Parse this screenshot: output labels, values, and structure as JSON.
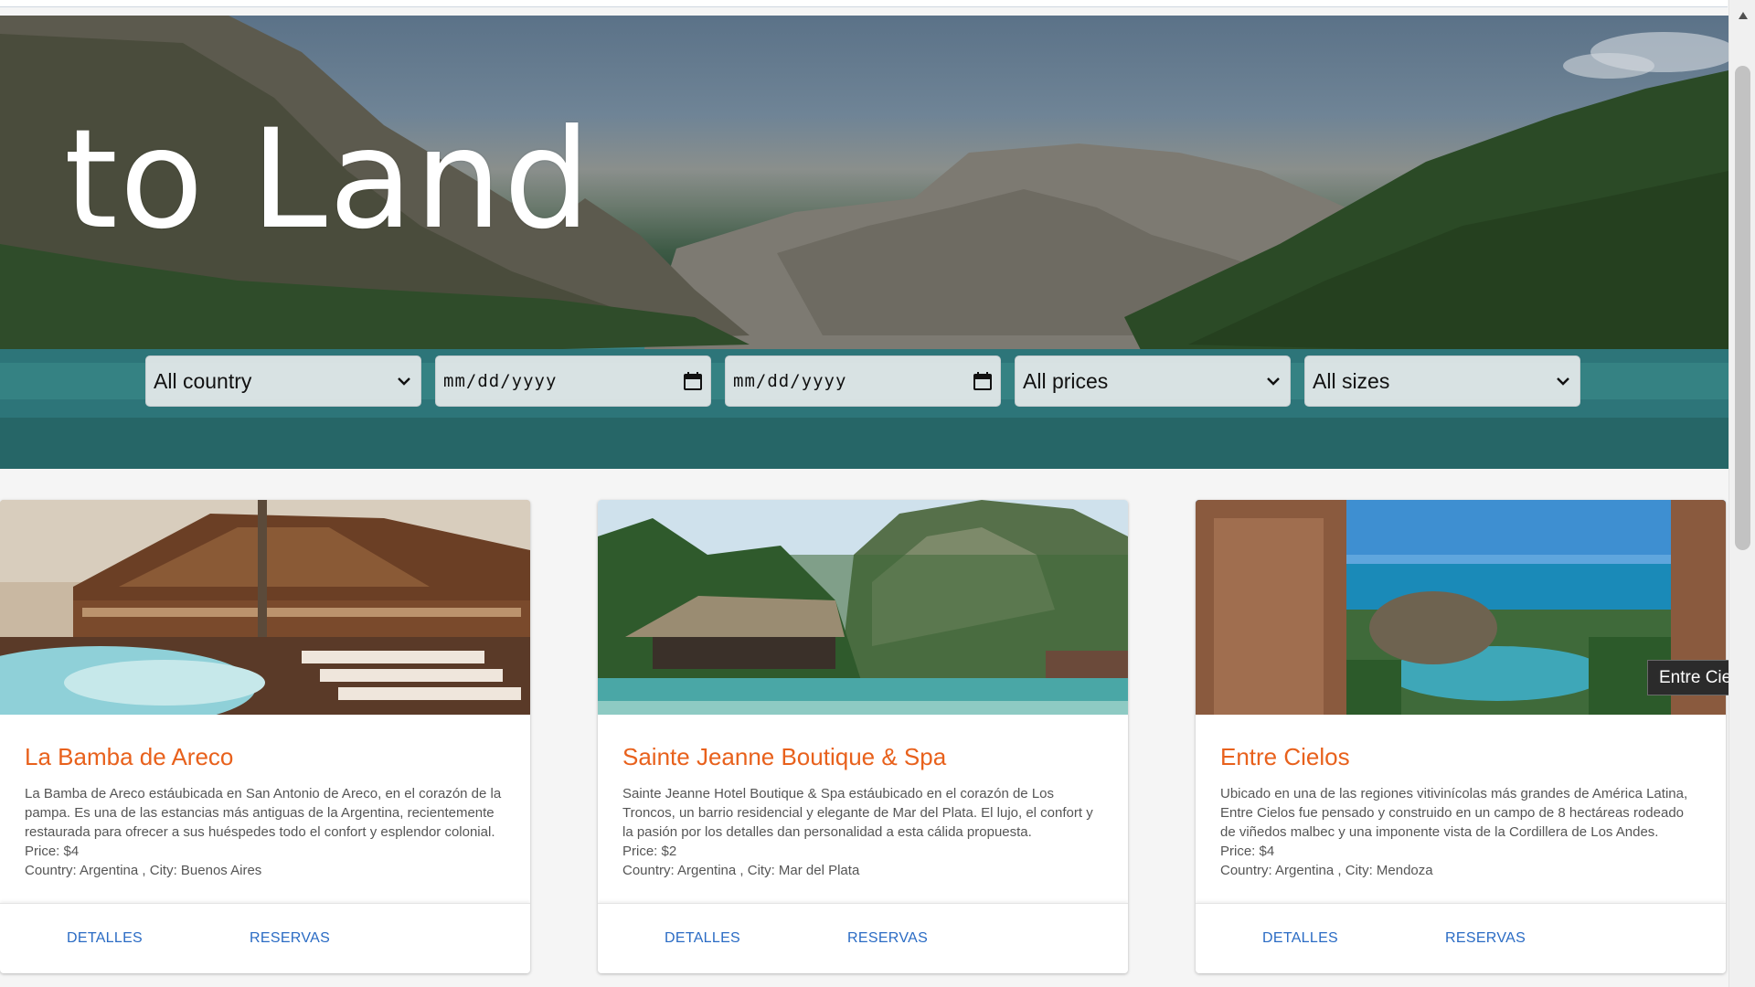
{
  "hero": {
    "title": "to Land",
    "filters": {
      "country": "All country",
      "check_in": "mm/dd/yyyy",
      "check_out": "mm/dd/yyyy",
      "prices": "All prices",
      "sizes": "All sizes"
    }
  },
  "hotels": [
    {
      "name": "La Bamba de Areco",
      "description": "La Bamba de Areco estáubicada en San Antonio de Areco, en el corazón de la pampa. Es una de las estancias más antiguas de la Argentina, recientemente restaurada para ofrecer a sus huéspedes todo el confort y esplendor colonial.",
      "price": "Price: $4",
      "location": "Country: Argentina , City: Buenos Aires",
      "details_label": "DETALLES",
      "reserve_label": "RESERVAS"
    },
    {
      "name": "Sainte Jeanne Boutique & Spa",
      "description": "Sainte Jeanne Hotel Boutique & Spa estáubicado en el corazón de Los Troncos, un barrio residencial y elegante de Mar del Plata. El lujo, el confort y la pasión por los detalles dan personalidad a esta cálida propuesta.",
      "price": "Price: $2",
      "location": "Country: Argentina , City: Mar del Plata",
      "details_label": "DETALLES",
      "reserve_label": "RESERVAS"
    },
    {
      "name": "Entre Cielos",
      "description": "Ubicado en una de las regiones vitivinícolas más grandes de América Latina, Entre Cielos fue pensado y construido en un campo de 8 hectáreas rodeado de viñedos malbec y una imponente vista de la Cordillera de Los Andes.",
      "price": "Price: $4",
      "location": "Country: Argentina , City: Mendoza",
      "details_label": "DETALLES",
      "reserve_label": "RESERVAS"
    }
  ],
  "tooltip": "Entre Cielos",
  "colors": {
    "title_accent": "#e8611c",
    "action_link": "#2a6bc4"
  },
  "icons": {
    "dropdown": "chevron-down-icon",
    "date": "calendar-icon"
  }
}
